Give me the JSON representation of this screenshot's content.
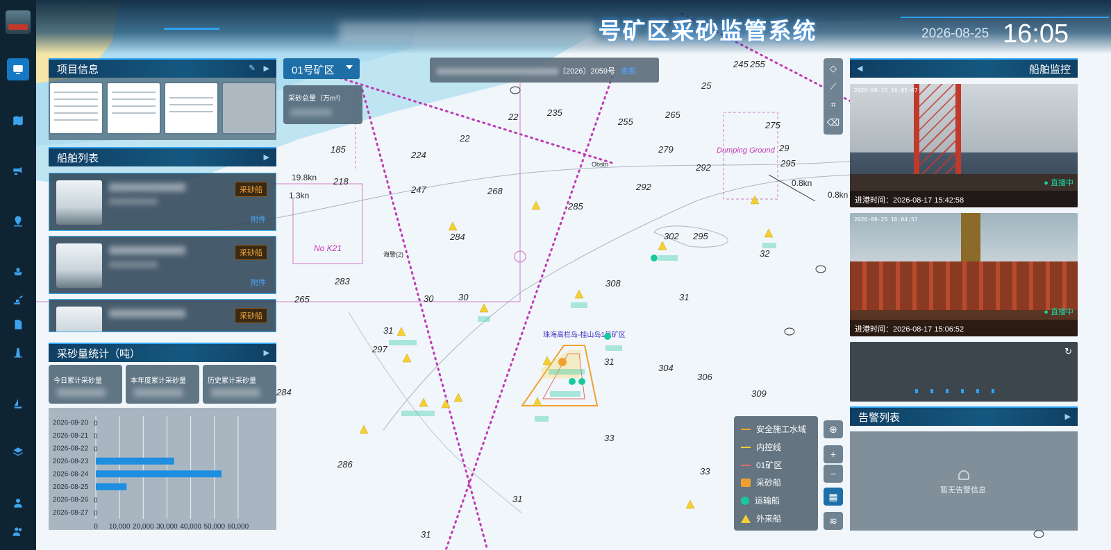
{
  "header": {
    "title_visible": "号矿区采砂监管系统",
    "date": "2026-08-25",
    "time": "16:05"
  },
  "sidebar": {
    "items": [
      "screen-icon",
      "map-icon",
      "camera-icon",
      "location-icon",
      "ship-icon",
      "excavator-icon",
      "document-icon",
      "lighthouse-icon",
      "sailboat-icon",
      "layers-icon",
      "user-icon",
      "users-icon"
    ]
  },
  "project_info": {
    "title": "项目信息"
  },
  "ship_list": {
    "title": "船舶列表",
    "cards": [
      {
        "badge": "采砂船",
        "attach": "附件"
      },
      {
        "badge": "采砂船",
        "attach": "附件"
      },
      {
        "badge": "采砂船"
      }
    ]
  },
  "sand_stats": {
    "title": "采砂量统计（吨）",
    "boxes": [
      "今日累计采砂量",
      "本年度累计采砂量",
      "历史累计采砂量"
    ]
  },
  "chart_data": {
    "type": "bar",
    "orientation": "horizontal",
    "categories": [
      "2026-08-20",
      "2026-08-21",
      "2026-08-22",
      "2026-08-23",
      "2026-08-24",
      "2026-08-25",
      "2026-08-26",
      "2026-08-27"
    ],
    "values": [
      0,
      0,
      0,
      33000,
      53000,
      13000,
      0,
      0
    ],
    "xlim": [
      0,
      65000
    ],
    "xticks": [
      "0",
      "10,000",
      "20,000",
      "30,000",
      "40,000",
      "50,000",
      "60,000"
    ],
    "zero_labels": [
      "0",
      "0",
      "0",
      "",
      "",
      "",
      "0",
      "0"
    ],
    "bar_color": "#1e8ee0",
    "grid": true
  },
  "mine_select": {
    "value": "01号矿区"
  },
  "total_box": {
    "label": "采砂总量（万m³）"
  },
  "notice": {
    "text_visible": "〔2026〕2059号",
    "link": "查看"
  },
  "ship_monitor": {
    "title": "船舶监控",
    "cams": [
      {
        "ts": "2026-08-25 16:05:07",
        "foot": "进港时间：2026-08-17 15:42:58",
        "live": "● 直播中"
      },
      {
        "ts": "2026-08-25 16:04:57",
        "foot": "进港时间：2026-08-17 15:06:52",
        "live": "● 直播中"
      }
    ]
  },
  "alarm": {
    "title": "告警列表",
    "empty": "暂无告警信息"
  },
  "legend": {
    "items": [
      {
        "label": "安全施工水域",
        "color": "#f0a030"
      },
      {
        "label": "内控线",
        "color": "#f5d030"
      },
      {
        "label": "01矿区",
        "color": "#e06a6a"
      },
      {
        "label": "采砂船",
        "color": "#f0a030"
      },
      {
        "label": "运输船",
        "color": "#18c9a0"
      },
      {
        "label": "外来船",
        "color": "#f5d030"
      }
    ]
  },
  "map": {
    "area_label": "珠海高栏岛-桂山岛1号矿区",
    "dumping": "Dumping Ground",
    "labels": [
      "0.8kn",
      "0.8kn",
      "1.3kn",
      "19.8kn",
      "Obstn",
      "No K21",
      "海警(2)",
      "30",
      "31",
      "32",
      "33"
    ]
  }
}
